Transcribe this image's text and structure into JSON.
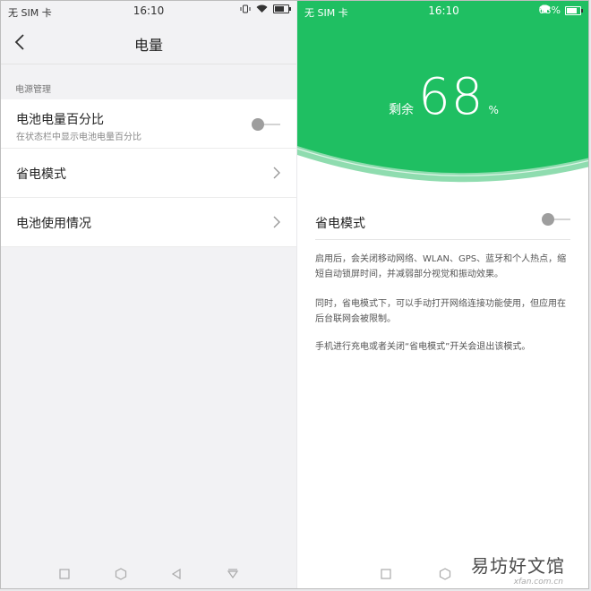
{
  "left": {
    "status": {
      "carrier": "无 SIM 卡",
      "time": "16:10"
    },
    "title": "电量",
    "section_label": "电源管理",
    "rows": [
      {
        "label": "电池电量百分比",
        "sub": "在状态栏中显示电池电量百分比",
        "control": "toggle",
        "toggle_on": false
      },
      {
        "label": "省电模式",
        "control": "chevron"
      },
      {
        "label": "电池使用情况",
        "control": "chevron"
      }
    ]
  },
  "right": {
    "status": {
      "carrier": "无 SIM 卡",
      "time": "16:10",
      "battery": "68%"
    },
    "remaining_prefix": "剩余",
    "battery_percent": "68",
    "percent_unit": "%",
    "mode_label": "省电模式",
    "mode_toggle_on": false,
    "descriptions": [
      "启用后，会关闭移动网络、WLAN、GPS、蓝牙和个人热点，缩短自动锁屏时间，并减弱部分视觉和振动效果。",
      "同时，省电模式下，可以手动打开网络连接功能使用，但应用在后台联网会被限制。",
      "手机进行充电或者关闭“省电模式”开关会退出该模式。"
    ]
  },
  "watermark": {
    "text": "易坊好文馆",
    "sub": "xfan.com.cn"
  },
  "colors": {
    "accent_green": "#1fbf62",
    "toggle_knob": "#9e9e9e"
  }
}
